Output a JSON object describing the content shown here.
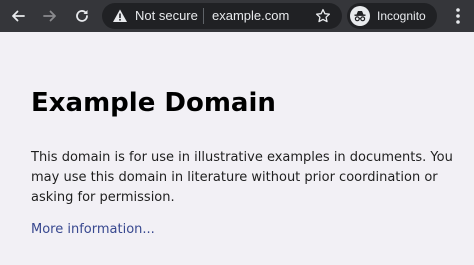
{
  "browser": {
    "back_icon": "arrow-left-icon",
    "forward_icon": "arrow-right-icon",
    "reload_icon": "reload-icon",
    "security_icon": "warning-triangle-icon",
    "security_label": "Not secure",
    "url": "example.com",
    "bookmark_icon": "star-icon",
    "incognito_icon": "incognito-icon",
    "incognito_label": "Incognito",
    "menu_icon": "three-dot-menu-icon"
  },
  "page": {
    "title": "Example Domain",
    "paragraph": "This domain is for use in illustrative examples in documents. You may use this domain in literature without prior coordination or asking for permission.",
    "link_text": "More information..."
  },
  "colors": {
    "toolbar": "#35363a",
    "omnibox": "#202124",
    "page_background": "#f2f0f5",
    "link": "#38488f"
  }
}
